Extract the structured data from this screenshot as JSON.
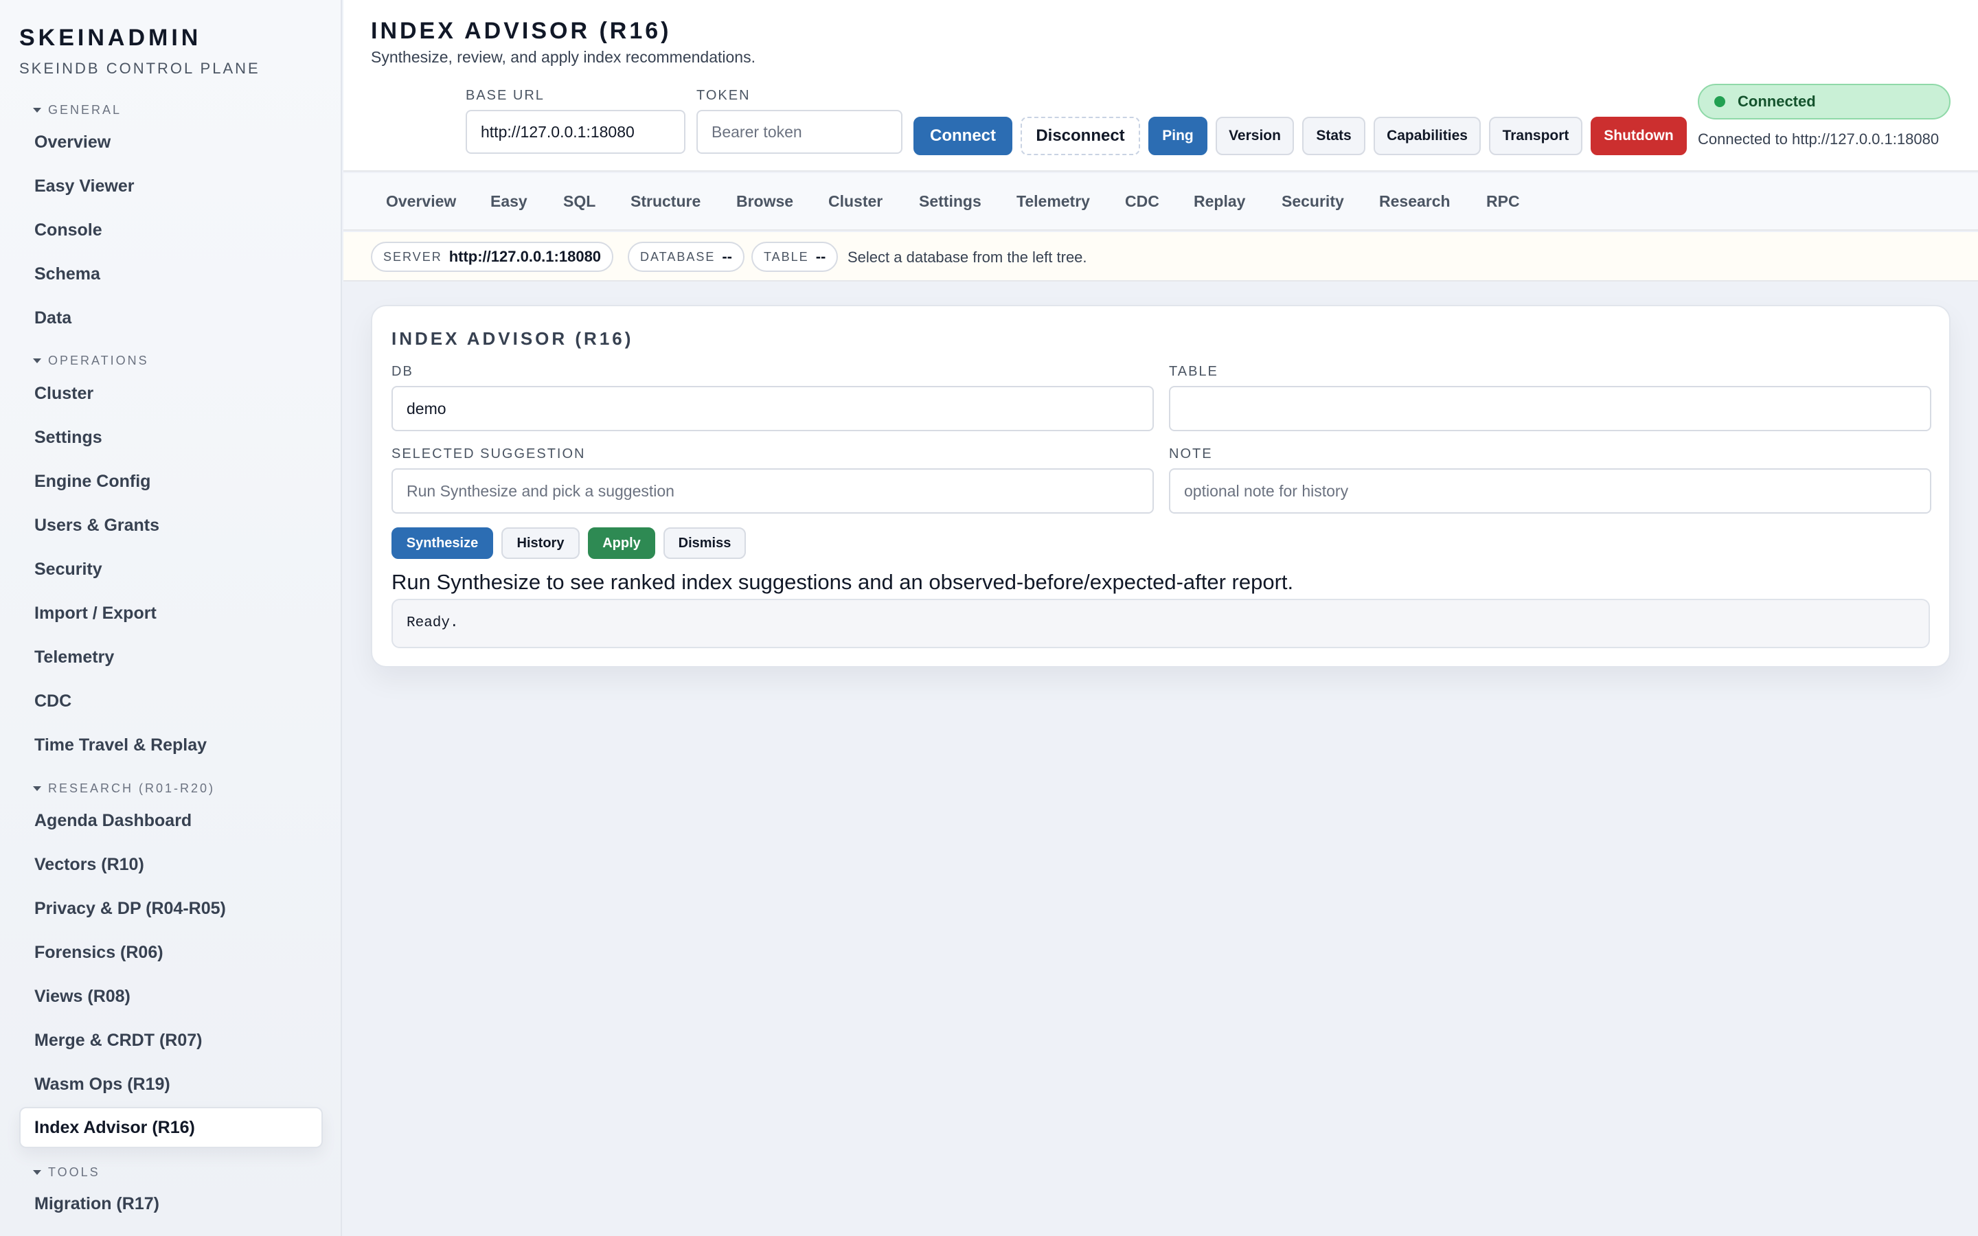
{
  "brand": {
    "title": "SKEINADMIN",
    "subtitle": "SKEINDB CONTROL PLANE"
  },
  "sidebar": {
    "sections": [
      {
        "title": "GENERAL",
        "items": [
          "Overview",
          "Easy Viewer",
          "Console",
          "Schema",
          "Data"
        ]
      },
      {
        "title": "OPERATIONS",
        "items": [
          "Cluster",
          "Settings",
          "Engine Config",
          "Users & Grants",
          "Security",
          "Import / Export",
          "Telemetry",
          "CDC",
          "Time Travel & Replay"
        ]
      },
      {
        "title": "RESEARCH (R01-R20)",
        "items": [
          "Agenda Dashboard",
          "Vectors (R10)",
          "Privacy & DP (R04-R05)",
          "Forensics (R06)",
          "Views (R08)",
          "Merge & CRDT (R07)",
          "Wasm Ops (R19)",
          "Index Advisor (R16)"
        ]
      },
      {
        "title": "TOOLS",
        "items": [
          "Migration (R17)"
        ]
      }
    ],
    "active": "Index Advisor (R16)"
  },
  "header": {
    "title": "INDEX ADVISOR (R16)",
    "subtitle": "Synthesize, review, and apply index recommendations.",
    "base_url_label": "BASE URL",
    "base_url_value": "http://127.0.0.1:18080",
    "token_label": "TOKEN",
    "token_placeholder": "Bearer token",
    "buttons": {
      "connect": "Connect",
      "disconnect": "Disconnect",
      "ping": "Ping",
      "version": "Version",
      "stats": "Stats",
      "capabilities": "Capabilities",
      "transport": "Transport",
      "shutdown": "Shutdown"
    },
    "status": "Connected",
    "status_detail": "Connected to http://127.0.0.1:18080",
    "status_color": "#22a052"
  },
  "tabs": [
    "Overview",
    "Easy",
    "SQL",
    "Structure",
    "Browse",
    "Cluster",
    "Settings",
    "Telemetry",
    "CDC",
    "Replay",
    "Security",
    "Research",
    "RPC"
  ],
  "context": {
    "server_key": "SERVER",
    "server_val": "http://127.0.0.1:18080",
    "database_key": "DATABASE",
    "database_val": "--",
    "table_key": "TABLE",
    "table_val": "--",
    "hint": "Select a database from the left tree."
  },
  "card": {
    "title": "INDEX ADVISOR (R16)",
    "db_label": "DB",
    "db_value": "demo",
    "table_label": "TABLE",
    "table_value": "",
    "suggestion_label": "SELECTED SUGGESTION",
    "suggestion_placeholder": "Run Synthesize and pick a suggestion",
    "note_label": "NOTE",
    "note_placeholder": "optional note for history",
    "buttons": {
      "synthesize": "Synthesize",
      "history": "History",
      "apply": "Apply",
      "dismiss": "Dismiss"
    },
    "message": "Run Synthesize to see ranked index suggestions and an observed-before/expected-after report.",
    "output": "Ready."
  }
}
